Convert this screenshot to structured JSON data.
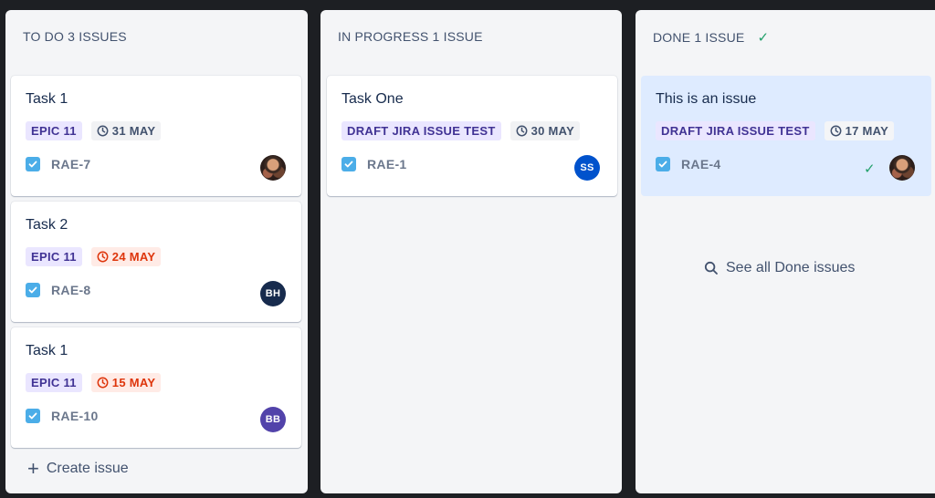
{
  "columns": {
    "todo": {
      "title": "TO DO 3 ISSUES"
    },
    "progress": {
      "title": "IN PROGRESS 1 ISSUE"
    },
    "done": {
      "title": "DONE 1 ISSUE",
      "check_icon": "check-icon"
    }
  },
  "cards": [
    {
      "title": "Task 1",
      "epic": "EPIC 11",
      "date": "31 MAY",
      "date_status": "normal",
      "key": "RAE-7",
      "avatar": {
        "type": "photo",
        "initials": ""
      }
    },
    {
      "title": "Task 2",
      "epic": "EPIC 11",
      "date": "24 MAY",
      "date_status": "overdue",
      "key": "RAE-8",
      "avatar": {
        "type": "initials",
        "initials": "BH",
        "color": "#172b4d"
      }
    },
    {
      "title": "Task 1",
      "epic": "EPIC 11",
      "date": "15 MAY",
      "date_status": "overdue",
      "key": "RAE-10",
      "avatar": {
        "type": "initials",
        "initials": "BB",
        "color": "#5243aa"
      }
    },
    {
      "title": "Task One",
      "epic": "DRAFT JIRA ISSUE TEST",
      "date": "30 MAY",
      "date_status": "normal",
      "key": "RAE-1",
      "avatar": {
        "type": "initials",
        "initials": "SS",
        "color": "#0052cc"
      }
    },
    {
      "title": "This is an issue",
      "epic": "DRAFT JIRA ISSUE TEST",
      "date": "17 MAY",
      "date_status": "normal",
      "key": "RAE-4",
      "avatar": {
        "type": "photo",
        "initials": ""
      }
    }
  ],
  "actions": {
    "create_issue": "Create issue",
    "see_all_done": "See all Done issues"
  },
  "colors": {
    "background": "#1d1f23",
    "column": "#f4f5f7",
    "selected_card": "#deebff",
    "epic_bg": "#eae6ff",
    "epic_text": "#403294",
    "overdue": "#de350b",
    "done_green": "#22a06b"
  }
}
